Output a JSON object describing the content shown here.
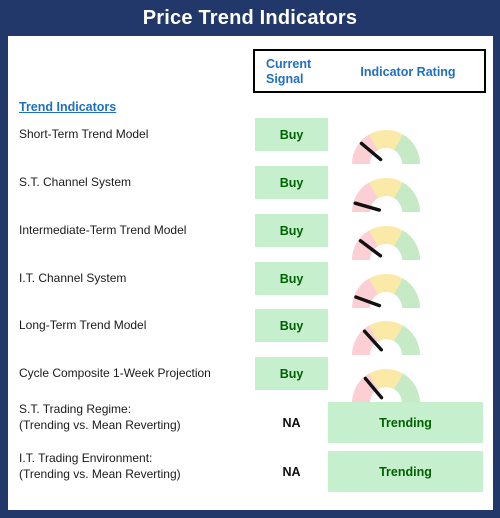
{
  "panel": {
    "title": "Price Trend Indicators",
    "frame_color": "#22386B",
    "title_color": "#FFFFFF"
  },
  "header": {
    "current_signal": "Current\nSignal",
    "current_signal_line1": "Current",
    "current_signal_line2": "Signal",
    "indicator_rating": "Indicator Rating",
    "text_color": "#1F6FC4"
  },
  "section": {
    "heading": "Trend Indicators",
    "heading_color": "#1F6FC4"
  },
  "legend": {
    "gauge_band_low": "#FBCFD3",
    "gauge_band_mid": "#FBE9A8",
    "gauge_band_high": "#C6E9C6",
    "needle_color": "#111111",
    "positive_fill": "#C6EFCE",
    "positive_text": "#016100"
  },
  "rows": [
    {
      "label": "Short-Term Trend Model",
      "signal": "Buy",
      "signal_type": "positive",
      "rating_type": "gauge",
      "needle_angle_deg": 40
    },
    {
      "label": "S.T. Channel System",
      "signal": "Buy",
      "signal_type": "positive",
      "rating_type": "gauge",
      "needle_angle_deg": 16
    },
    {
      "label": "Intermediate-Term Trend Model",
      "signal": "Buy",
      "signal_type": "positive",
      "rating_type": "gauge",
      "needle_angle_deg": 37
    },
    {
      "label": "I.T. Channel System",
      "signal": "Buy",
      "signal_type": "positive",
      "rating_type": "gauge",
      "needle_angle_deg": 20
    },
    {
      "label": "Long-Term Trend Model",
      "signal": "Buy",
      "signal_type": "positive",
      "rating_type": "gauge",
      "needle_angle_deg": 48
    },
    {
      "label": "Cycle Composite 1-Week Projection",
      "signal": "Buy",
      "signal_type": "positive",
      "rating_type": "gauge",
      "needle_angle_deg": 50
    },
    {
      "label_line1": "S.T. Trading Regime:",
      "label_line2": "(Trending vs. Mean Reverting)",
      "signal": "NA",
      "signal_type": "na",
      "rating_type": "text",
      "rating_text": "Trending"
    },
    {
      "label_line1": "I.T. Trading Environment:",
      "label_line2": "(Trending vs. Mean Reverting)",
      "signal": "NA",
      "signal_type": "na",
      "rating_type": "text",
      "rating_text": "Trending"
    }
  ]
}
